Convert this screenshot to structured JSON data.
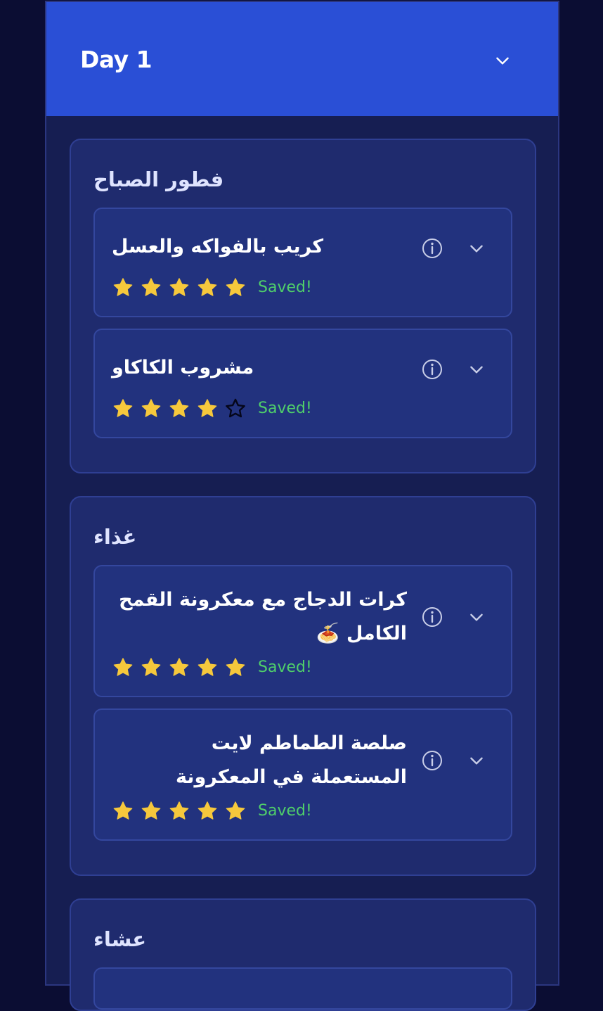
{
  "day": {
    "title": "Day 1"
  },
  "colors": {
    "star_filled": "#f6c83c",
    "star_empty_stroke": "#05061a",
    "saved": "#4fcf6a",
    "header": "#2a4fd6"
  },
  "meals": [
    {
      "title": "فطور الصباح",
      "recipes": [
        {
          "name": "كريب بالفواكه والعسل",
          "rating": 5,
          "status": "Saved!"
        },
        {
          "name": "مشروب الكاكاو",
          "rating": 4,
          "status": "Saved!"
        }
      ]
    },
    {
      "title": "غذاء",
      "recipes": [
        {
          "name": "كرات الدجاج مع معكرونة القمح الكامل 🍝",
          "rating": 5,
          "status": "Saved!"
        },
        {
          "name": "صلصة الطماطم لايت المستعملة في المعكرونة",
          "rating": 5,
          "status": "Saved!"
        }
      ]
    },
    {
      "title": "عشاء",
      "recipes": []
    }
  ]
}
